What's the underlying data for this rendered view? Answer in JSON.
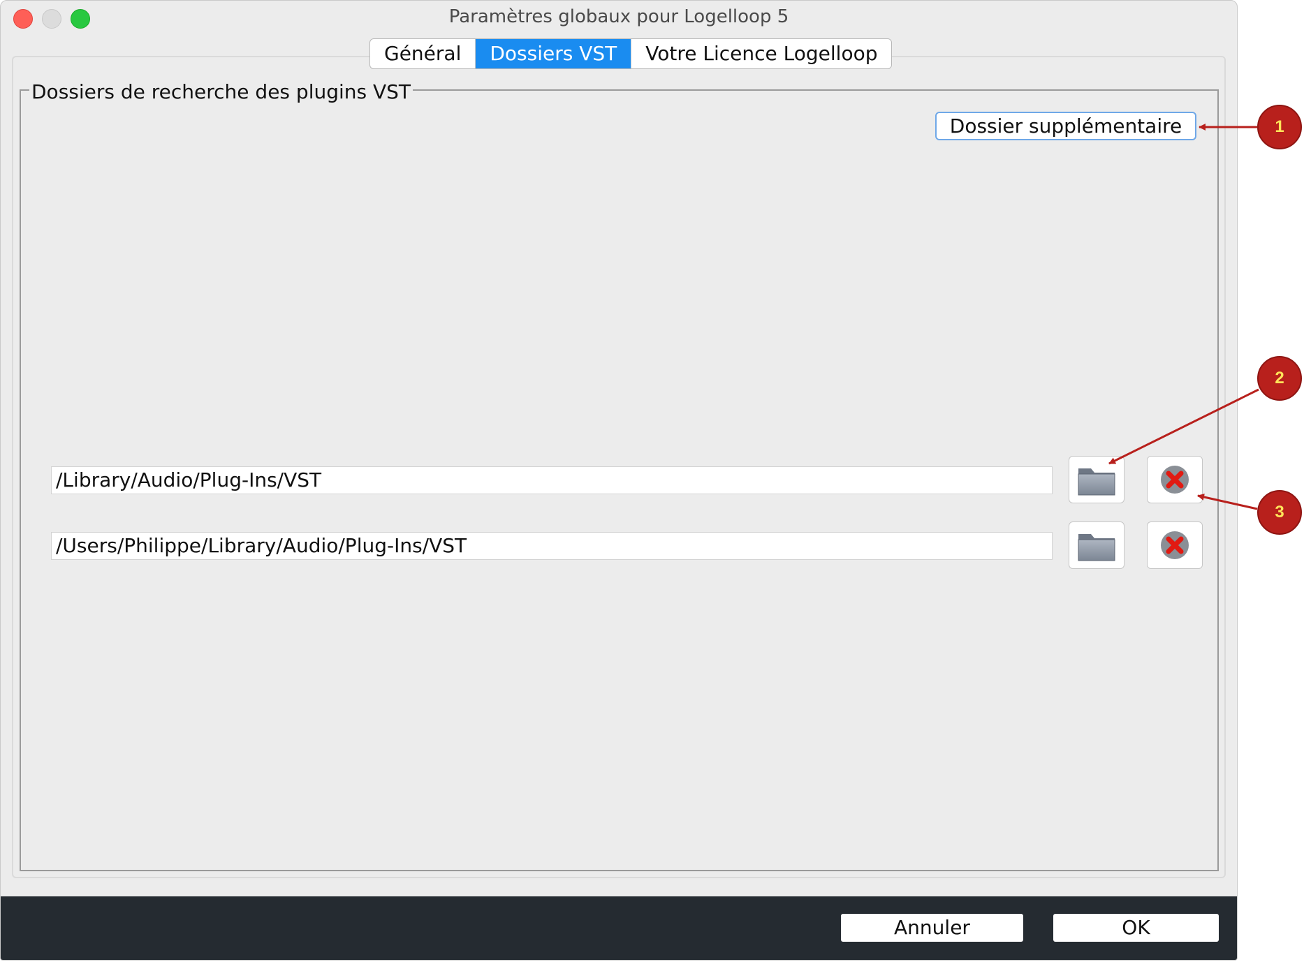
{
  "window": {
    "title": "Paramètres globaux pour Logelloop 5"
  },
  "tabs": [
    {
      "label": "Général",
      "active": false
    },
    {
      "label": "Dossiers VST",
      "active": true
    },
    {
      "label": "Votre Licence Logelloop",
      "active": false
    }
  ],
  "vst": {
    "group_label": "Dossiers de recherche des plugins VST",
    "add_button": "Dossier supplémentaire",
    "paths": [
      "/Library/Audio/Plug-Ins/VST",
      "/Users/Philippe/Library/Audio/Plug-Ins/VST"
    ],
    "row_icons": [
      "folder-icon",
      "remove-icon"
    ]
  },
  "footer": {
    "cancel": "Annuler",
    "ok": "OK"
  },
  "callouts": [
    "1",
    "2",
    "3"
  ],
  "colors": {
    "active_tab": "#1a8cf0",
    "callout": "#b8201c",
    "callout_text": "#ffe45a",
    "footer_bg": "#252b31"
  }
}
